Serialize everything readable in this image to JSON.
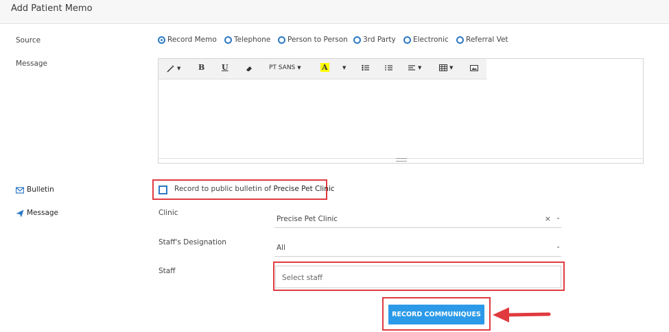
{
  "header": {
    "title": "Add Patient Memo"
  },
  "form": {
    "source_label": "Source",
    "message_label": "Message",
    "bulletin_label": "Bulletin",
    "message_side_label": "Message",
    "clinic_label": "Clinic",
    "designation_label": "Staff's Designation",
    "staff_label": "Staff"
  },
  "source_options": [
    {
      "label": "Record Memo",
      "selected": true
    },
    {
      "label": "Telephone",
      "selected": false
    },
    {
      "label": "Person to Person",
      "selected": false
    },
    {
      "label": "3rd Party",
      "selected": false
    },
    {
      "label": "Electronic",
      "selected": false
    },
    {
      "label": "Referral Vet",
      "selected": false
    }
  ],
  "editor": {
    "font_name": "PT SANS"
  },
  "bulletin": {
    "text": "Record to public bulletin of ",
    "clinic_name": "Precise Pet Clinic",
    "checked": false
  },
  "clinic_select": {
    "value": "Precise Pet Clinic",
    "clear_symbol": "×"
  },
  "designation_select": {
    "value": "All"
  },
  "staff_input": {
    "placeholder": "Select staff"
  },
  "actions": {
    "record_label": "RECORD COMMUNIQUES"
  },
  "colors": {
    "accent": "#2a78c5",
    "button": "#2c9ae8",
    "highlight": "#e03a3f"
  }
}
